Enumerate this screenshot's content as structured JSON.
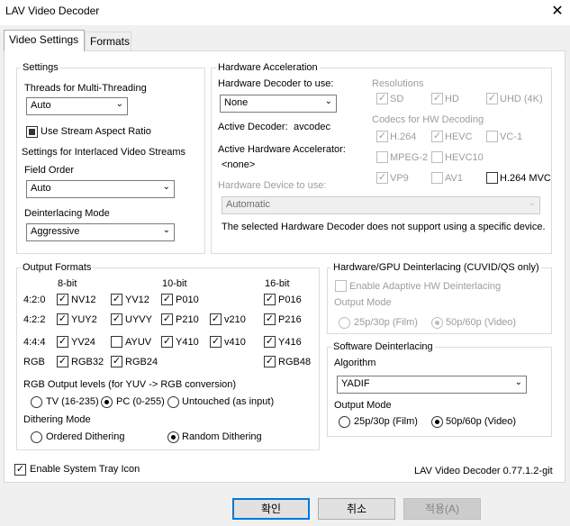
{
  "window": {
    "title": "LAV Video Decoder"
  },
  "tabs": [
    "Video Settings",
    "Formats"
  ],
  "settings": {
    "group_title": "Settings",
    "threads_label": "Threads for Multi-Threading",
    "threads_value": "Auto",
    "stream_aspect_label": "Use Stream Aspect Ratio",
    "interlaced_label": "Settings for Interlaced Video Streams",
    "field_order_label": "Field Order",
    "field_order_value": "Auto",
    "deint_mode_label": "Deinterlacing Mode",
    "deint_mode_value": "Aggressive"
  },
  "hwaccel": {
    "group_title": "Hardware Acceleration",
    "decoder_label": "Hardware Decoder to use:",
    "decoder_value": "None",
    "active_decoder_label": "Active Decoder:",
    "active_decoder_value": "avcodec",
    "active_accel_label": "Active Hardware Accelerator:",
    "active_accel_value": "<none>",
    "device_label": "Hardware Device to use:",
    "device_value": "Automatic",
    "note": "The selected Hardware Decoder does not support using a specific device.",
    "resolutions_label": "Resolutions",
    "res": {
      "sd": "SD",
      "hd": "HD",
      "uhd": "UHD (4K)"
    },
    "codecs_label": "Codecs for HW Decoding",
    "codecs": {
      "h264": "H.264",
      "hevc": "HEVC",
      "vc1": "VC-1",
      "mpeg2": "MPEG-2",
      "hevc10": "HEVC10",
      "vp9": "VP9",
      "av1": "AV1",
      "h264mvc": "H.264 MVC"
    }
  },
  "output": {
    "group_title": "Output Formats",
    "col_8bit": "8-bit",
    "col_10bit": "10-bit",
    "col_16bit": "16-bit",
    "row_420": "4:2:0",
    "row_422": "4:2:2",
    "row_444": "4:4:4",
    "row_rgb": "RGB",
    "f": {
      "nv12": "NV12",
      "yv12": "YV12",
      "p010": "P010",
      "p016": "P016",
      "yuy2": "YUY2",
      "uyvy": "UYVY",
      "p210": "P210",
      "v210": "v210",
      "p216": "P216",
      "yv24": "YV24",
      "ayuv": "AYUV",
      "y410": "Y410",
      "v410": "v410",
      "y416": "Y416",
      "rgb32": "RGB32",
      "rgb24": "RGB24",
      "rgb48": "RGB48"
    },
    "levels_label": "RGB Output levels (for YUV -> RGB conversion)",
    "levels": {
      "tv": "TV (16-235)",
      "pc": "PC (0-255)",
      "untouched": "Untouched (as input)"
    },
    "dither_label": "Dithering Mode",
    "dither": {
      "ordered": "Ordered Dithering",
      "random": "Random Dithering"
    }
  },
  "hwdeint": {
    "group_title": "Hardware/GPU Deinterlacing (CUVID/QS only)",
    "enable_label": "Enable Adaptive HW Deinterlacing",
    "output_mode_label": "Output Mode",
    "film": "25p/30p (Film)",
    "video": "50p/60p (Video)"
  },
  "swdeint": {
    "group_title": "Software Deinterlacing",
    "algorithm_label": "Algorithm",
    "algorithm_value": "YADIF",
    "output_mode_label": "Output Mode",
    "film": "25p/30p (Film)",
    "video": "50p/60p (Video)"
  },
  "footer": {
    "tray_label": "Enable System Tray Icon",
    "version": "LAV Video Decoder 0.77.1.2-git",
    "ok": "확인",
    "cancel": "취소",
    "apply": "적용(A)"
  }
}
